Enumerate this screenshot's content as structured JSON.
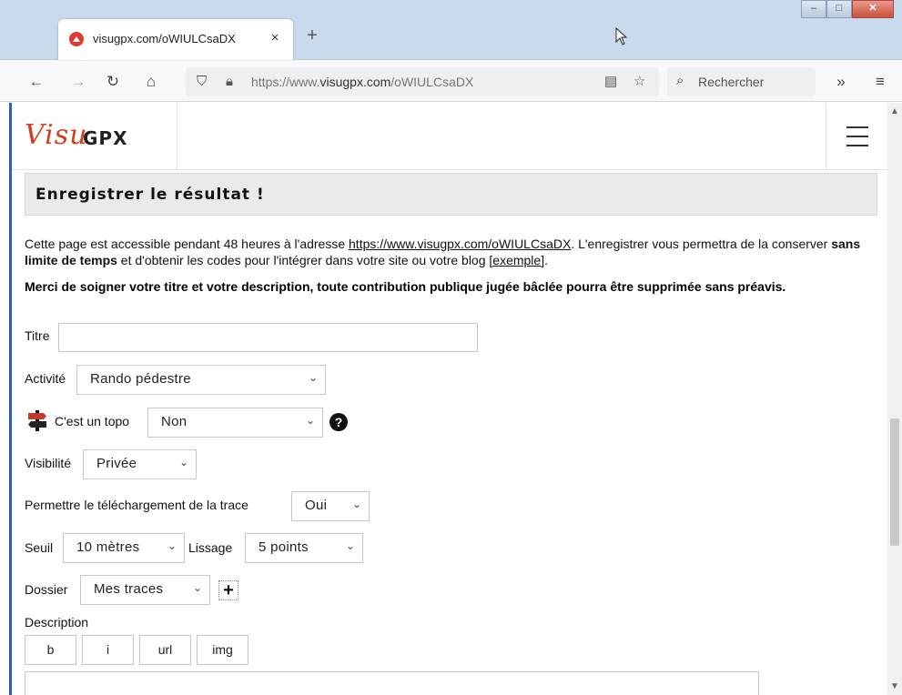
{
  "browser": {
    "tab_title": "visugpx.com/oWIULCsaDX",
    "tab_close": "×",
    "new_tab": "+",
    "url_prefix": "https://www.",
    "url_domain": "visugpx.com",
    "url_path": "/oWIULCsaDX",
    "search_placeholder": "Rechercher",
    "window_controls": [
      "–",
      "□",
      "✕"
    ]
  },
  "site": {
    "logo_visu": "Visu",
    "logo_gpx": "GPX"
  },
  "section": {
    "title": "Enregistrer le résultat !"
  },
  "intro": {
    "part1": "Cette page est accessible pendant 48 heures à l'adresse ",
    "link": "https://www.visugpx.com/oWIULCsaDX",
    "part2": ". L'enregistrer vous permettra de la conserver ",
    "bold": "sans limite de temps",
    "part3": " et d'obtenir les codes pour l'intégrer dans votre site ou votre blog ",
    "example_link": "[exemple]",
    "part4": "."
  },
  "warning": "Merci de soigner votre titre et votre description, toute contribution publique jugée bâclée pourra être supprimée sans préavis.",
  "form": {
    "titre_label": "Titre",
    "titre_value": "",
    "activite_label": "Activité",
    "activite_value": "Rando pédestre",
    "topo_label": "C'est un topo",
    "topo_value": "Non",
    "help": "?",
    "visibilite_label": "Visibilité",
    "visibilite_value": "Privée",
    "telechargement_label": "Permettre le téléchargement de la trace",
    "telechargement_value": "Oui",
    "seuil_label": "Seuil",
    "seuil_value": "10 mètres",
    "lissage_label": "Lissage",
    "lissage_value": "5 points",
    "dossier_label": "Dossier",
    "dossier_value": "Mes traces",
    "add_folder": "+",
    "description_label": "Description",
    "editor_buttons": [
      "b",
      "i",
      "url",
      "img"
    ],
    "description_value": ""
  },
  "icons": {
    "chevron": "⌄"
  }
}
